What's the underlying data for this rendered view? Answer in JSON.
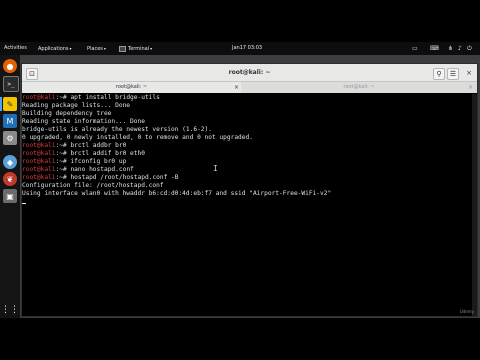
{
  "topbar": {
    "activities": "Activities",
    "applications": "Applications",
    "places": "Places",
    "terminal": "Terminal",
    "clock": "Jan17 03:03",
    "dropdown_arrow": "▾"
  },
  "dock": {
    "icons": [
      "firefox-icon",
      "terminal-icon",
      "notes-icon",
      "metasploit-icon",
      "armitage-icon",
      "burpsuite-icon",
      "cherrytree-icon",
      "recordmydesktop-icon",
      "apps-grid-icon"
    ]
  },
  "window": {
    "title": "root@kali: ~",
    "tabs": [
      {
        "label": "root@kali: ~",
        "close": "×"
      },
      {
        "label": "root@kali: ~",
        "close": "×"
      }
    ]
  },
  "terminal": {
    "prompt": "root@kali",
    "prompt_suffix": ":~# ",
    "lines": [
      {
        "prompt": true,
        "text": "apt install bridge-utils"
      },
      {
        "prompt": false,
        "text": "Reading package lists... Done"
      },
      {
        "prompt": false,
        "text": "Building dependency tree"
      },
      {
        "prompt": false,
        "text": "Reading state information... Done"
      },
      {
        "prompt": false,
        "text": "bridge-utils is already the newest version (1.6-2)."
      },
      {
        "prompt": false,
        "text": "0 upgraded, 0 newly installed, 0 to remove and 0 not upgraded."
      },
      {
        "prompt": true,
        "text": "brctl addbr br0"
      },
      {
        "prompt": true,
        "text": "brctl addif br0 eth0"
      },
      {
        "prompt": true,
        "text": "ifconfig br0 up"
      },
      {
        "prompt": true,
        "text": "nano hostapd.conf"
      },
      {
        "prompt": true,
        "text": "hostapd /root/hostapd.conf -B"
      },
      {
        "prompt": false,
        "text": "Configuration file: /root/hostapd.conf"
      },
      {
        "prompt": false,
        "text": "Using interface wlan0 with hwaddr b6:cd:d0:4d:eb:f7 and ssid \"Airport-Free-WiFi-v2\""
      }
    ]
  },
  "watermark": "Udemy",
  "colors": {
    "prompt": "#d83a3a",
    "text": "#e0e0e0",
    "background": "#000000",
    "topbar": "#0d0d0d"
  }
}
